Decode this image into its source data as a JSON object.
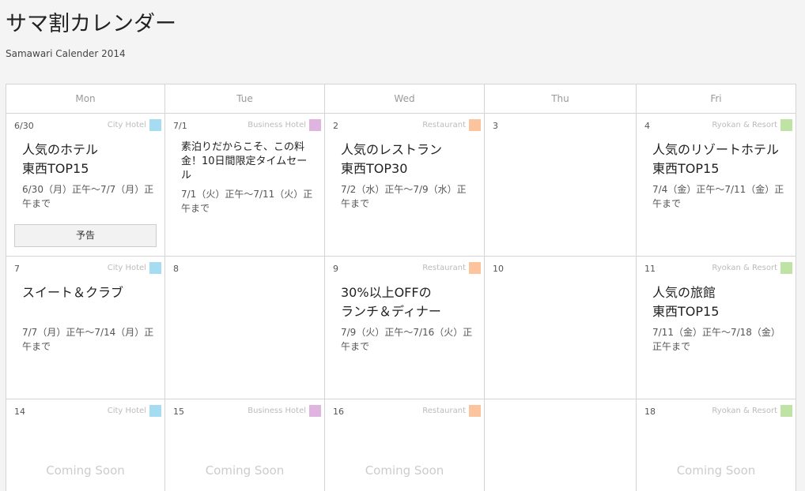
{
  "page": {
    "title": "サマ割カレンダー",
    "subtitle": "Samawari Calender 2014"
  },
  "colors": {
    "City Hotel": "#a6dcf2",
    "Business Hotel": "#dfb4df",
    "Restaurant": "#fbc49c",
    "Ryokan & Resort": "#bfe3a4"
  },
  "calendar": {
    "days": [
      "Mon",
      "Tue",
      "Wed",
      "Thu",
      "Fri"
    ],
    "weeks": [
      {
        "cells": [
          {
            "date": "6/30",
            "category": "City Hotel",
            "title": "人気のホテル\n東西TOP15",
            "period": "6/30（月）正午〜7/7（月）正午まで",
            "button": "予告"
          },
          {
            "date": "7/1",
            "category": "Business Hotel",
            "title": "素泊りだからこそ、この料金！10日間限定タイムセール",
            "period": "7/1（火）正午〜7/11（火）正午まで",
            "small": true
          },
          {
            "date": "2",
            "category": "Restaurant",
            "title": "人気のレストラン\n東西TOP30",
            "period": "7/2（水）正午〜7/9（水）正午まで"
          },
          {
            "date": "3"
          },
          {
            "date": "4",
            "category": "Ryokan & Resort",
            "title": "人気のリゾートホテル東西TOP15",
            "period": "7/4（金）正午〜7/11（金）正午まで"
          }
        ]
      },
      {
        "cells": [
          {
            "date": "7",
            "category": "City Hotel",
            "title": "スイート＆クラブ",
            "period": "7/7（月）正午〜7/14（月）正午まで"
          },
          {
            "date": "8"
          },
          {
            "date": "9",
            "category": "Restaurant",
            "title": "30%以上OFFの\nランチ＆ディナー",
            "period": "7/9（火）正午〜7/16（火）正午まで"
          },
          {
            "date": "10"
          },
          {
            "date": "11",
            "category": "Ryokan & Resort",
            "title": "人気の旅館\n東西TOP15",
            "period": "7/11（金）正午〜7/18（金）正午まで"
          }
        ]
      },
      {
        "cells": [
          {
            "date": "14",
            "category": "City Hotel",
            "coming": "Coming Soon"
          },
          {
            "date": "15",
            "category": "Business Hotel",
            "coming": "Coming Soon"
          },
          {
            "date": "16",
            "category": "Restaurant",
            "coming": "Coming Soon"
          },
          {},
          {
            "date": "18",
            "category": "Ryokan & Resort",
            "coming": "Coming Soon"
          }
        ]
      }
    ]
  }
}
